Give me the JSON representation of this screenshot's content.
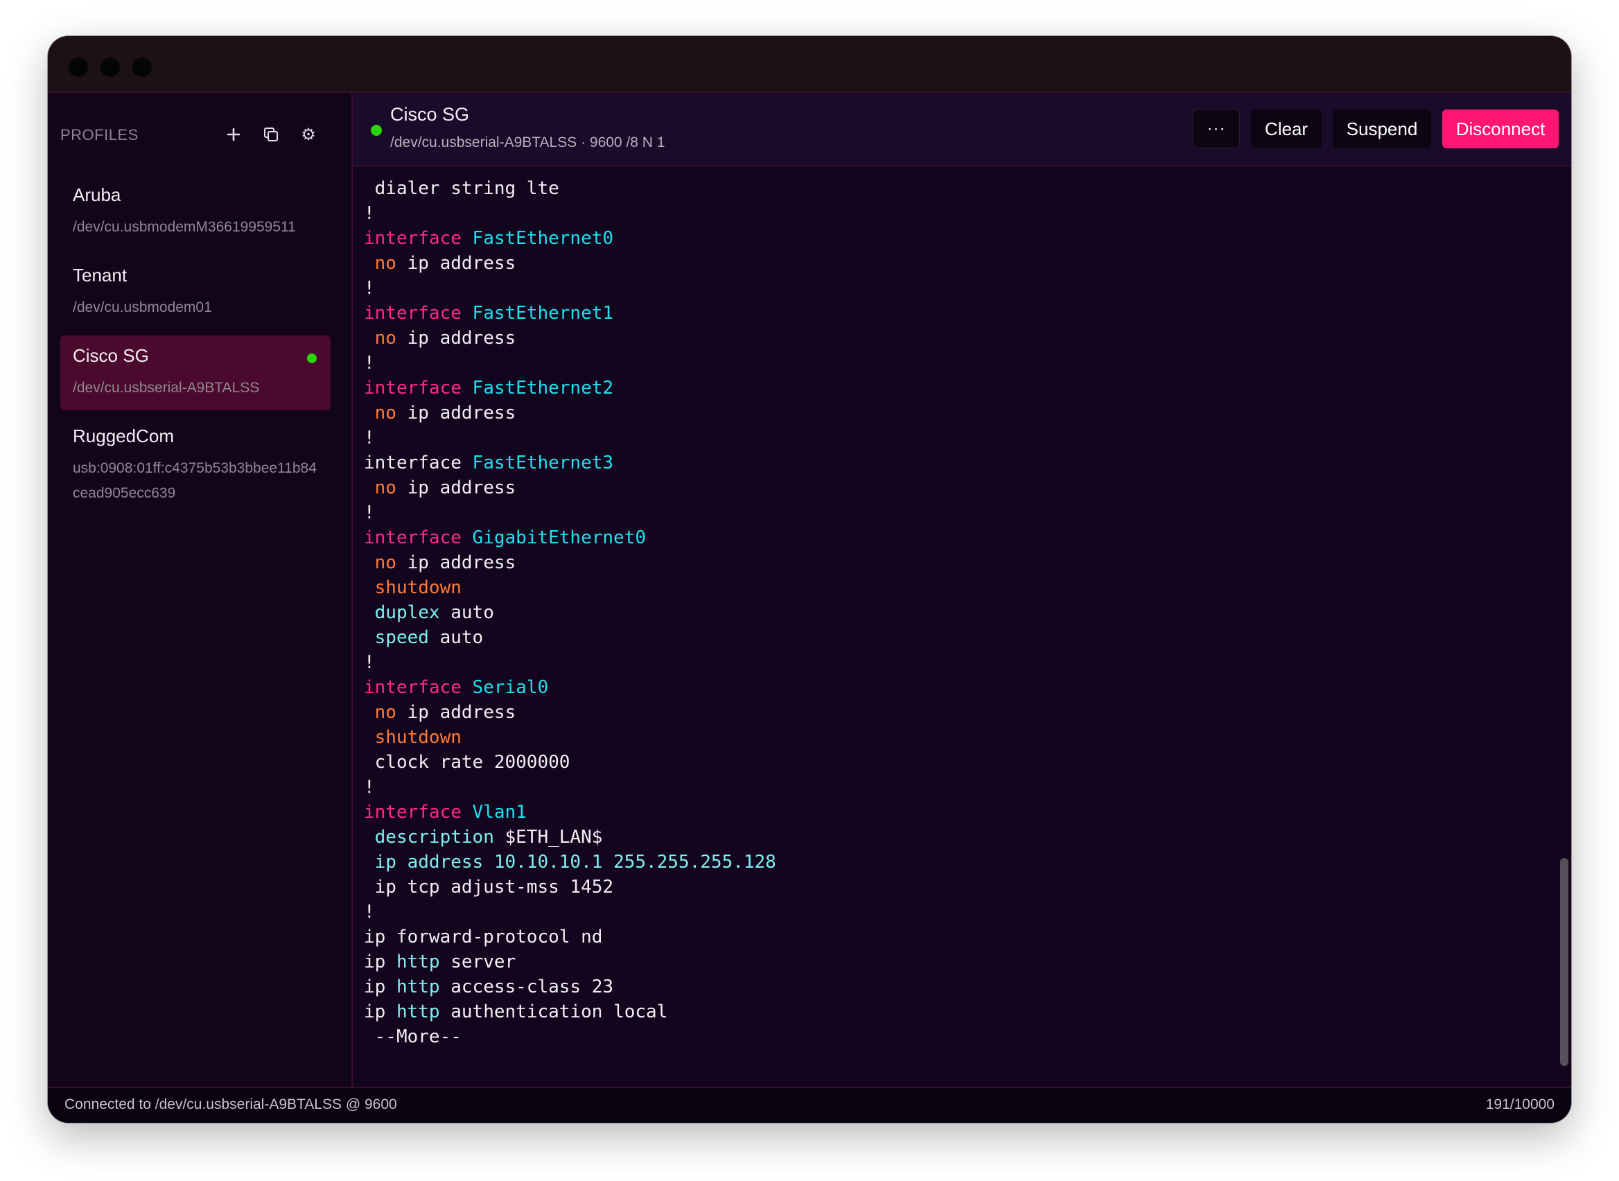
{
  "sidebar": {
    "title": "PROFILES",
    "icons": {
      "add": "plus-icon",
      "duplicate": "copy-icon",
      "settings": "gear-icon"
    },
    "profiles": [
      {
        "name": "Aruba",
        "path": "/dev/cu.usbmodemM36619959511",
        "active": false,
        "connected": false
      },
      {
        "name": "Tenant",
        "path": "/dev/cu.usbmodem01",
        "active": false,
        "connected": false
      },
      {
        "name": "Cisco SG",
        "path": "/dev/cu.usbserial-A9BTALSS",
        "active": true,
        "connected": true
      },
      {
        "name": "RuggedCom",
        "path": "usb:0908:01ff:c4375b53b3bbee11b84cead905ecc639",
        "active": false,
        "connected": false
      }
    ]
  },
  "connection": {
    "title": "Cisco SG",
    "subtitle": "/dev/cu.usbserial-A9BTALSS · 9600 /8 N 1",
    "status_color": "#29d40c"
  },
  "toolbar": {
    "more_label": "···",
    "clear_label": "Clear",
    "suspend_label": "Suspend",
    "disconnect_label": "Disconnect",
    "disconnect_color": "#ff1572"
  },
  "terminal": {
    "lines": [
      [
        [
          "plain",
          " dialer string lte"
        ]
      ],
      [
        [
          "plain",
          "!"
        ]
      ],
      [
        [
          "kw",
          "interface "
        ],
        [
          "name",
          "FastEthernet0"
        ]
      ],
      [
        [
          "plain",
          " "
        ],
        [
          "neg",
          "no"
        ],
        [
          "plain",
          " ip address"
        ]
      ],
      [
        [
          "plain",
          "!"
        ]
      ],
      [
        [
          "kw",
          "interface "
        ],
        [
          "name",
          "FastEthernet1"
        ]
      ],
      [
        [
          "plain",
          " "
        ],
        [
          "neg",
          "no"
        ],
        [
          "plain",
          " ip address"
        ]
      ],
      [
        [
          "plain",
          "!"
        ]
      ],
      [
        [
          "kw",
          "interface "
        ],
        [
          "name",
          "FastEthernet2"
        ]
      ],
      [
        [
          "plain",
          " "
        ],
        [
          "neg",
          "no"
        ],
        [
          "plain",
          " ip address"
        ]
      ],
      [
        [
          "plain",
          "!"
        ]
      ],
      [
        [
          "plain",
          "interface "
        ],
        [
          "name",
          "FastEthernet3"
        ]
      ],
      [
        [
          "plain",
          " "
        ],
        [
          "neg",
          "no"
        ],
        [
          "plain",
          " ip address"
        ]
      ],
      [
        [
          "plain",
          "!"
        ]
      ],
      [
        [
          "kw",
          "interface "
        ],
        [
          "name",
          "GigabitEthernet0"
        ]
      ],
      [
        [
          "plain",
          " "
        ],
        [
          "neg",
          "no"
        ],
        [
          "plain",
          " ip address"
        ]
      ],
      [
        [
          "plain",
          " "
        ],
        [
          "neg",
          "shutdown"
        ]
      ],
      [
        [
          "plain",
          " "
        ],
        [
          "cmd",
          "duplex"
        ],
        [
          "plain",
          " auto"
        ]
      ],
      [
        [
          "plain",
          " "
        ],
        [
          "cmd",
          "speed"
        ],
        [
          "plain",
          " auto"
        ]
      ],
      [
        [
          "plain",
          "!"
        ]
      ],
      [
        [
          "kw",
          "interface "
        ],
        [
          "name",
          "Serial0"
        ]
      ],
      [
        [
          "plain",
          " "
        ],
        [
          "neg",
          "no"
        ],
        [
          "plain",
          " ip address"
        ]
      ],
      [
        [
          "plain",
          " "
        ],
        [
          "neg",
          "shutdown"
        ]
      ],
      [
        [
          "plain",
          " clock rate 2000000"
        ]
      ],
      [
        [
          "plain",
          "!"
        ]
      ],
      [
        [
          "kw",
          "interface "
        ],
        [
          "name",
          "Vlan1"
        ]
      ],
      [
        [
          "plain",
          " "
        ],
        [
          "cmd",
          "description"
        ],
        [
          "plain",
          " $ETH_LAN$"
        ]
      ],
      [
        [
          "plain",
          " "
        ],
        [
          "cmd",
          "ip address 10.10.10.1 255.255.255.128"
        ]
      ],
      [
        [
          "plain",
          " ip tcp adjust-mss 1452"
        ]
      ],
      [
        [
          "plain",
          "!"
        ]
      ],
      [
        [
          "plain",
          "ip forward-protocol nd"
        ]
      ],
      [
        [
          "plain",
          "ip "
        ],
        [
          "cmd",
          "http"
        ],
        [
          "plain",
          " server"
        ]
      ],
      [
        [
          "plain",
          "ip "
        ],
        [
          "cmd",
          "http"
        ],
        [
          "plain",
          " access-class 23"
        ]
      ],
      [
        [
          "plain",
          "ip "
        ],
        [
          "cmd",
          "http"
        ],
        [
          "plain",
          " authentication local"
        ]
      ],
      [
        [
          "plain",
          " --More--"
        ]
      ]
    ]
  },
  "statusbar": {
    "left": "Connected to /dev/cu.usbserial-A9BTALSS @ 9600",
    "right": "191/10000"
  }
}
